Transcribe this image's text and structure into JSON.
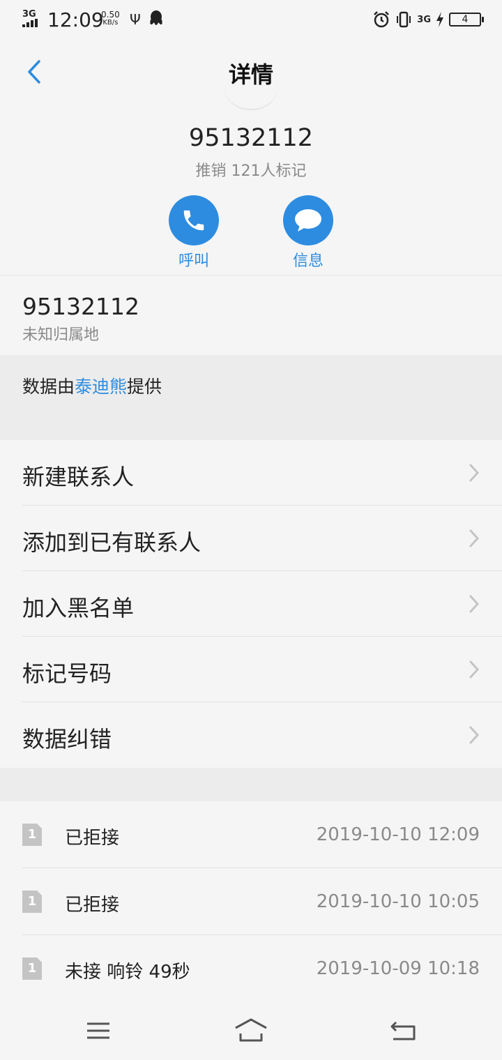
{
  "status_bar": {
    "network": "3G",
    "time": "12:09",
    "speed_value": "0.50",
    "speed_unit": "KB/s",
    "net2": "3G",
    "battery": "4",
    "icons": [
      "signal-icon",
      "usb-icon",
      "qq-icon",
      "alarm-icon",
      "vibrate-icon",
      "charging-icon",
      "battery-icon"
    ]
  },
  "header": {
    "title": "详情"
  },
  "hero": {
    "number": "95132112",
    "tag": "推销 121人标记",
    "call_label": "呼叫",
    "message_label": "信息",
    "accent_color": "#2d8ce0"
  },
  "info": {
    "number": "95132112",
    "location": "未知归属地"
  },
  "source": {
    "prefix": "数据由",
    "provider": "泰迪熊",
    "suffix": "提供"
  },
  "menu": {
    "items": [
      {
        "label": "新建联系人"
      },
      {
        "label": "添加到已有联系人"
      },
      {
        "label": "加入黑名单"
      },
      {
        "label": "标记号码"
      },
      {
        "label": "数据纠错"
      }
    ]
  },
  "call_log": {
    "items": [
      {
        "sim": "1",
        "status": "已拒接",
        "time": "2019-10-10 12:09"
      },
      {
        "sim": "1",
        "status": "已拒接",
        "time": "2019-10-10 10:05"
      },
      {
        "sim": "1",
        "status": "未接 响铃 49秒",
        "time": "2019-10-09 10:18"
      }
    ]
  }
}
